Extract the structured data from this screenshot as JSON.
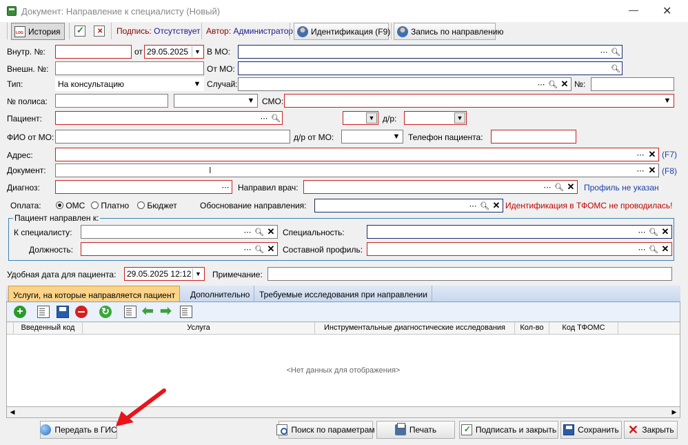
{
  "window": {
    "title": "Документ: Направление к специалисту (Новый)",
    "minimize": "—",
    "close": "✕"
  },
  "toolbar": {
    "history": "История",
    "signature_label": "Подпись:",
    "signature_value": "Отсутствует",
    "author_label": "Автор:",
    "author_value": "Администратор",
    "identification": "Идентификация  (F9)",
    "appointment": "Запись по направлению"
  },
  "form": {
    "internal_no_label": "Внутр. №:",
    "date_from_label": "от",
    "date_value": "29.05.2025",
    "to_mo_label": "В МО:",
    "external_no_label": "Внешн. №:",
    "from_mo_label": "От МО:",
    "type_label": "Тип:",
    "type_value": "На консультацию",
    "case_label": "Случай:",
    "number_label": "№:",
    "policy_label": "№ полиса:",
    "smo_label": "СМО:",
    "patient_label": "Пациент:",
    "dob_label": "д/р:",
    "fio_label": "ФИО от МО:",
    "dob_mo_label": "д/р от МО:",
    "phone_label": "Телефон пациента:",
    "address_label": "Адрес:",
    "address_hotkey": "(F7)",
    "document_label": "Документ:",
    "document_hotkey": "(F8)",
    "diagnosis_label": "Диагноз:",
    "doctor_label": "Направил врач:",
    "profile_status": "Профиль не указан",
    "payment_label": "Оплата:",
    "payment_options": [
      "ОМС",
      "Платно",
      "Бюджет"
    ],
    "reason_label": "Обоснование направления:",
    "tfoms_status": "Идентификация в ТФОМС не проводилась!",
    "group_title": "Пациент направлен к:",
    "specialist_label": "К специалисту:",
    "specialty_label": "Специальность:",
    "position_label": "Должность:",
    "composite_profile_label": "Составной профиль:",
    "convenient_date_label": "Удобная дата для пациента:",
    "convenient_date_value": "29.05.2025 12:12",
    "note_label": "Примечание:"
  },
  "tabs": [
    "Услуги, на которые направляется пациент",
    "Дополнительно",
    "Требуемые исследования при направлении"
  ],
  "grid": {
    "columns": [
      "Введенный код",
      "Услуга",
      "Инструментальные диагностические исследования",
      "Кол-во",
      "Код ТФОМС"
    ],
    "empty_text": "<Нет данных для отображения>"
  },
  "bottom": {
    "send_gis": "Передать в ГИС",
    "search_params": "Поиск по параметрам",
    "print": "Печать",
    "sign_close": "Подписать и закрыть",
    "save": "Сохранить",
    "close": "Закрыть"
  },
  "colors": {
    "required_border": "#c81e1e",
    "link": "#1a3fa8",
    "warning": "#c00000",
    "tab_active": "#fbd48a",
    "annotation_arrow": "#e8141a"
  }
}
